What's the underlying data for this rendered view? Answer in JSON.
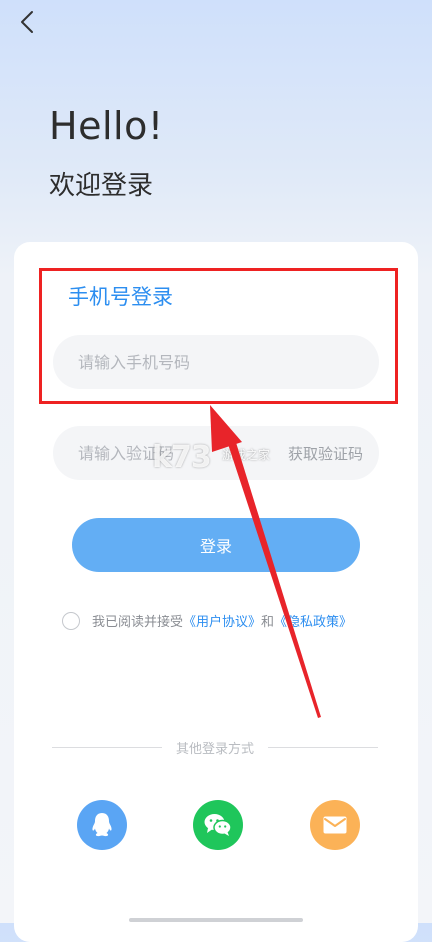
{
  "header": {
    "back_icon": "chevron-left-icon"
  },
  "hero": {
    "greeting": "Hello!",
    "welcome": "欢迎登录"
  },
  "form": {
    "tab_title": "手机号登录",
    "phone_placeholder": "请输入手机号码",
    "code_placeholder": "请输入验证码",
    "get_code_label": "获取验证码",
    "login_label": "登录"
  },
  "agreement": {
    "prefix": "我已阅读并接受",
    "user_agreement": "《用户协议》",
    "and": "和",
    "privacy_policy": "《隐私政策》"
  },
  "other_login": {
    "label": "其他登录方式",
    "options": [
      {
        "icon": "qq-icon",
        "color": "#5aa5f4"
      },
      {
        "icon": "wechat-icon",
        "color": "#1fc65b"
      },
      {
        "icon": "mail-icon",
        "color": "#fbb257"
      }
    ]
  },
  "overlay": {
    "watermark": "k73",
    "watermark_sub": "游戏之家",
    "highlight_color": "#ee2222"
  },
  "colors": {
    "accent": "#2c8ef0",
    "button": "#63aef4"
  }
}
